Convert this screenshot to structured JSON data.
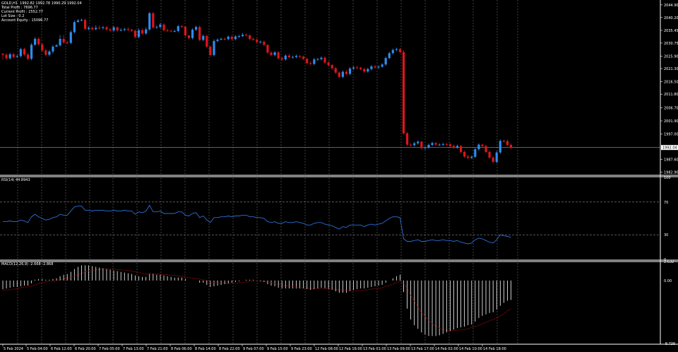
{
  "info": {
    "title": "GOLD,H1  1992.82 1992.78 1990.29 1992.04",
    "lines": [
      "Total Profit : 7696.77",
      "Current Profit : 2552.77",
      "Lot Size : 0.2",
      "Account Equity : 15096.77"
    ]
  },
  "colors": {
    "up": "#2e8cf0",
    "down": "#e0141b",
    "rsi": "#2b6fd6",
    "macd_hist": "#ffffff",
    "macd_signal": "#d01010",
    "grid": "#6a6a6a",
    "text": "#ffffff"
  },
  "chart_data": [
    {
      "type": "candlestick",
      "title": "GOLD,H1",
      "ylim": [
        1982.0,
        2046.7
      ],
      "y_ticks": [
        "2044.90",
        "2040.20",
        "2035.45",
        "2030.75",
        "2025.90",
        "2021.30",
        "2016.50",
        "2011.80",
        "2006.70",
        "2001.90",
        "1997.00",
        "1992.04",
        "1987.60",
        "1982.90"
      ],
      "price_line": 1992.04,
      "closes": [
        2026.4,
        2025.1,
        2026.6,
        2025.6,
        2025.9,
        2028.5,
        2026.5,
        2024.9,
        2030.1,
        2032.3,
        2030.3,
        2028.0,
        2026.4,
        2027.6,
        2029.4,
        2029.9,
        2032.3,
        2031.0,
        2030.8,
        2034.8,
        2038.5,
        2039.1,
        2039.3,
        2036.0,
        2036.4,
        2035.9,
        2036.4,
        2036.3,
        2036.6,
        2035.8,
        2035.4,
        2036.6,
        2035.4,
        2035.6,
        2035.9,
        2035.7,
        2035.3,
        2033.0,
        2035.5,
        2034.3,
        2035.8,
        2041.8,
        2036.5,
        2036.7,
        2037.6,
        2035.5,
        2035.3,
        2035.2,
        2035.2,
        2037.0,
        2036.8,
        2033.6,
        2032.6,
        2035.7,
        2036.7,
        2031.9,
        2033.4,
        2029.4,
        2026.3,
        2031.5,
        2032.0,
        2032.3,
        2032.2,
        2033.1,
        2032.2,
        2033.2,
        2033.3,
        2033.8,
        2033.6,
        2032.3,
        2032.0,
        2031.1,
        2031.2,
        2030.1,
        2027.2,
        2026.3,
        2027.3,
        2025.1,
        2024.7,
        2026.1,
        2025.5,
        2025.6,
        2026.0,
        2025.7,
        2024.9,
        2023.3,
        2023.0,
        2024.7,
        2024.8,
        2025.3,
        2023.5,
        2022.6,
        2021.4,
        2019.8,
        2018.2,
        2020.1,
        2019.3,
        2021.3,
        2021.7,
        2021.6,
        2021.1,
        2020.2,
        2021.1,
        2022.1,
        2021.7,
        2022.0,
        2022.8,
        2025.2,
        2027.0,
        2028.2,
        2028.5,
        2027.4,
        1997.3,
        1993.1,
        1992.9,
        1993.6,
        1994.2,
        1991.8,
        1992.1,
        1993.0,
        1993.7,
        1993.1,
        1993.1,
        1993.3,
        1993.2,
        1992.6,
        1992.0,
        1992.6,
        1990.4,
        1988.7,
        1988.2,
        1988.6,
        1991.4,
        1993.1,
        1992.6,
        1990.4,
        1988.3,
        1986.7,
        1990.2,
        1994.5,
        1994.4,
        1993.0,
        1992.0
      ],
      "highs": [
        2027.0,
        2027.0,
        2027.2,
        2027.2,
        2026.5,
        2029.0,
        2029.0,
        2027.1,
        2030.7,
        2032.9,
        2032.9,
        2030.8,
        2028.6,
        2028.2,
        2030.0,
        2030.4,
        2033.7,
        2033.7,
        2031.6,
        2035.4,
        2039.1,
        2039.6,
        2039.8,
        2039.8,
        2036.9,
        2036.9,
        2037.3,
        2037.3,
        2037.1,
        2037.1,
        2036.3,
        2037.1,
        2036.9,
        2036.2,
        2036.4,
        2036.5,
        2036.0,
        2035.7,
        2036.2,
        2036.2,
        2036.6,
        2042.3,
        2042.3,
        2037.3,
        2038.2,
        2038.1,
        2036.1,
        2035.7,
        2035.7,
        2037.5,
        2037.5,
        2037.0,
        2033.2,
        2036.2,
        2037.2,
        2037.2,
        2033.9,
        2033.9,
        2029.8,
        2032.1,
        2032.5,
        2032.8,
        2032.9,
        2033.6,
        2033.6,
        2033.7,
        2033.8,
        2034.5,
        2034.2,
        2034.0,
        2032.8,
        2032.5,
        2031.7,
        2031.7,
        2030.1,
        2027.8,
        2027.8,
        2027.8,
        2025.6,
        2026.6,
        2026.7,
        2026.1,
        2026.5,
        2026.3,
        2026.1,
        2025.3,
        2024.0,
        2025.3,
        2025.3,
        2025.8,
        2025.8,
        2024.1,
        2022.9,
        2021.9,
        2020.3,
        2020.6,
        2020.7,
        2021.8,
        2022.2,
        2022.3,
        2022.0,
        2021.6,
        2021.6,
        2022.6,
        2022.6,
        2022.5,
        2023.3,
        2025.7,
        2027.5,
        2028.7,
        2029.0,
        2028.8,
        2028.1,
        1997.8,
        1993.6,
        1994.1,
        1994.7,
        1994.5,
        1992.6,
        1993.5,
        1994.2,
        1994.1,
        1993.6,
        1993.8,
        1993.8,
        1993.7,
        1993.1,
        1993.1,
        1992.9,
        1990.9,
        1989.3,
        1989.1,
        1991.9,
        1993.6,
        1993.4,
        1993.0,
        1990.9,
        1988.8,
        1990.7,
        1995.0,
        1994.9,
        1995.0,
        1993.5
      ],
      "lows": [
        2024.6,
        2024.5,
        2024.6,
        2025.1,
        2025.3,
        2025.4,
        2025.9,
        2024.4,
        2024.4,
        2029.8,
        2029.8,
        2027.5,
        2025.8,
        2025.8,
        2026.9,
        2029.4,
        2029.4,
        2030.4,
        2030.3,
        2030.3,
        2034.3,
        2038.5,
        2038.8,
        2035.5,
        2035.5,
        2035.4,
        2035.4,
        2035.8,
        2035.8,
        2035.3,
        2034.9,
        2035.0,
        2034.9,
        2035.1,
        2035.1,
        2035.2,
        2034.8,
        2032.5,
        2032.5,
        2033.8,
        2033.8,
        2035.3,
        2036.0,
        2036.0,
        2036.2,
        2035.0,
        2034.8,
        2034.7,
        2034.7,
        2034.7,
        2036.3,
        2033.1,
        2032.1,
        2032.1,
        2035.2,
        2031.4,
        2031.4,
        2028.9,
        2025.8,
        2025.8,
        2031.0,
        2031.8,
        2031.7,
        2031.7,
        2031.7,
        2031.7,
        2032.7,
        2033.0,
        2033.1,
        2031.8,
        2031.5,
        2030.6,
        2030.6,
        2029.6,
        2026.7,
        2025.8,
        2025.8,
        2024.6,
        2024.2,
        2024.2,
        2025.0,
        2025.0,
        2025.1,
        2025.2,
        2024.4,
        2022.8,
        2022.5,
        2022.5,
        2024.2,
        2024.3,
        2023.0,
        2022.1,
        2020.9,
        2019.3,
        2017.7,
        2017.7,
        2018.8,
        2018.8,
        2020.8,
        2021.1,
        2020.6,
        2019.7,
        2019.7,
        2020.6,
        2021.2,
        2021.2,
        2021.5,
        2022.3,
        2024.7,
        2026.5,
        2027.7,
        2026.9,
        1996.8,
        1992.6,
        1992.4,
        1992.4,
        1993.1,
        1991.3,
        1991.3,
        1991.6,
        1992.5,
        1992.6,
        1992.6,
        1992.6,
        1992.7,
        1992.1,
        1991.5,
        1991.5,
        1989.9,
        1988.2,
        1987.7,
        1987.7,
        1988.1,
        1990.9,
        1992.1,
        1989.9,
        1987.8,
        1986.2,
        1986.2,
        1989.7,
        1993.9,
        1992.5,
        1991.5
      ]
    },
    {
      "type": "line",
      "title": "RSI(14) 44.8943",
      "ylim": [
        0,
        100
      ],
      "levels": [
        70,
        30
      ],
      "y_ticks": [
        "100",
        "70",
        "30",
        "0"
      ],
      "values": [
        46,
        46,
        47,
        46,
        46,
        48,
        47,
        45,
        52,
        55,
        52,
        50,
        48,
        49,
        51,
        52,
        55,
        54,
        54,
        59,
        64,
        65,
        65,
        60,
        60,
        59,
        60,
        60,
        60,
        59,
        59,
        60,
        59,
        59,
        60,
        59,
        59,
        55,
        58,
        57,
        59,
        66,
        58,
        58,
        59,
        56,
        56,
        56,
        56,
        58,
        58,
        54,
        53,
        56,
        57,
        51,
        53,
        48,
        45,
        51,
        51,
        52,
        52,
        53,
        52,
        53,
        53,
        54,
        54,
        52,
        52,
        51,
        51,
        50,
        46,
        45,
        46,
        44,
        44,
        46,
        45,
        45,
        46,
        45,
        44,
        42,
        42,
        44,
        45,
        45,
        43,
        42,
        41,
        39,
        37,
        40,
        39,
        42,
        42,
        42,
        42,
        40,
        42,
        43,
        42,
        43,
        44,
        47,
        50,
        52,
        52,
        51,
        25,
        22,
        22,
        23,
        24,
        22,
        22,
        23,
        24,
        23,
        23,
        24,
        23,
        23,
        22,
        23,
        21,
        20,
        19,
        20,
        24,
        26,
        25,
        23,
        21,
        20,
        24,
        30,
        29,
        28,
        27
      ]
    },
    {
      "type": "bar",
      "title": "MACD(12,26,9) -2.668 -2.868",
      "ylim": [
        -8.738,
        2.632
      ],
      "y_ticks": [
        "2.632",
        "0.00",
        "-8.738"
      ],
      "values": [
        -1.2,
        -1.1,
        -1.0,
        -0.9,
        -0.9,
        -0.8,
        -0.7,
        -0.7,
        -0.4,
        0.1,
        0.2,
        0.2,
        0.1,
        0.1,
        0.2,
        0.3,
        0.6,
        0.8,
        0.9,
        1.2,
        1.6,
        1.9,
        2.1,
        2.1,
        2.1,
        2.0,
        1.9,
        1.8,
        1.7,
        1.6,
        1.5,
        1.4,
        1.3,
        1.2,
        1.1,
        1.0,
        0.9,
        0.7,
        0.6,
        0.5,
        0.5,
        0.9,
        0.9,
        0.8,
        0.8,
        0.7,
        0.6,
        0.5,
        0.4,
        0.4,
        0.4,
        0.2,
        0.0,
        0.0,
        0.0,
        -0.3,
        -0.3,
        -0.6,
        -0.9,
        -0.8,
        -0.7,
        -0.6,
        -0.5,
        -0.4,
        -0.3,
        -0.2,
        -0.1,
        0.0,
        0.1,
        0.1,
        0.1,
        0.0,
        -0.1,
        -0.2,
        -0.5,
        -0.7,
        -0.8,
        -1.0,
        -1.1,
        -1.1,
        -1.1,
        -1.1,
        -1.1,
        -1.1,
        -1.1,
        -1.2,
        -1.3,
        -1.2,
        -1.1,
        -1.0,
        -1.1,
        -1.2,
        -1.3,
        -1.5,
        -1.7,
        -1.7,
        -1.7,
        -1.5,
        -1.3,
        -1.2,
        -1.1,
        -1.1,
        -1.0,
        -0.9,
        -0.8,
        -0.7,
        -0.6,
        -0.3,
        0.0,
        0.3,
        0.6,
        0.8,
        -1.6,
        -3.9,
        -5.4,
        -6.2,
        -6.7,
        -7.2,
        -7.5,
        -7.7,
        -7.7,
        -7.7,
        -7.6,
        -7.4,
        -7.2,
        -7.0,
        -6.8,
        -6.6,
        -6.5,
        -6.4,
        -6.2,
        -6.1,
        -5.7,
        -5.2,
        -4.9,
        -4.7,
        -4.5,
        -4.4,
        -4.0,
        -3.5,
        -3.1,
        -2.8,
        -2.7
      ],
      "signal": [
        -1.4,
        -1.3,
        -1.3,
        -1.2,
        -1.1,
        -1.0,
        -0.9,
        -0.9,
        -0.8,
        -0.6,
        -0.4,
        -0.3,
        -0.2,
        -0.1,
        -0.1,
        0.0,
        0.1,
        0.2,
        0.3,
        0.4,
        0.6,
        0.8,
        1.0,
        1.2,
        1.3,
        1.4,
        1.5,
        1.5,
        1.6,
        1.6,
        1.6,
        1.6,
        1.5,
        1.5,
        1.4,
        1.4,
        1.3,
        1.2,
        1.1,
        1.0,
        0.9,
        0.9,
        0.9,
        0.9,
        0.9,
        0.8,
        0.8,
        0.7,
        0.7,
        0.6,
        0.6,
        0.5,
        0.4,
        0.3,
        0.3,
        0.2,
        0.1,
        0.0,
        -0.2,
        -0.3,
        -0.4,
        -0.4,
        -0.4,
        -0.4,
        -0.4,
        -0.4,
        -0.3,
        -0.3,
        -0.2,
        -0.1,
        -0.1,
        -0.1,
        -0.1,
        -0.1,
        -0.2,
        -0.3,
        -0.4,
        -0.5,
        -0.6,
        -0.7,
        -0.8,
        -0.9,
        -0.9,
        -1.0,
        -1.0,
        -1.0,
        -1.1,
        -1.1,
        -1.1,
        -1.1,
        -1.1,
        -1.1,
        -1.2,
        -1.2,
        -1.3,
        -1.4,
        -1.4,
        -1.4,
        -1.4,
        -1.4,
        -1.4,
        -1.3,
        -1.3,
        -1.2,
        -1.1,
        -1.1,
        -1.0,
        -0.8,
        -0.7,
        -0.5,
        -0.3,
        -0.1,
        -0.4,
        -1.1,
        -2.0,
        -2.9,
        -3.7,
        -4.4,
        -5.0,
        -5.5,
        -6.0,
        -6.3,
        -6.6,
        -6.8,
        -6.9,
        -6.9,
        -6.9,
        -6.9,
        -6.8,
        -6.8,
        -6.7,
        -6.5,
        -6.4,
        -6.2,
        -6.0,
        -5.8,
        -5.6,
        -5.4,
        -5.2,
        -4.9,
        -4.6,
        -4.2,
        -3.9
      ]
    }
  ],
  "x_ticks": [
    "5 Feb 2024",
    "5 Feb 04:00",
    "6 Feb 12:00",
    "6 Feb 20:00",
    "7 Feb 05:00",
    "7 Feb 13:00",
    "7 Feb 21:00",
    "8 Feb 06:00",
    "8 Feb 14:00",
    "8 Feb 22:00",
    "9 Feb 07:00",
    "9 Feb 15:00",
    "9 Feb 23:00",
    "12 Feb 08:00",
    "12 Feb 16:00",
    "13 Feb 01:00",
    "13 Feb 09:00",
    "13 Feb 17:00",
    "14 Feb 02:00",
    "14 Feb 10:00",
    "14 Feb 18:00"
  ]
}
